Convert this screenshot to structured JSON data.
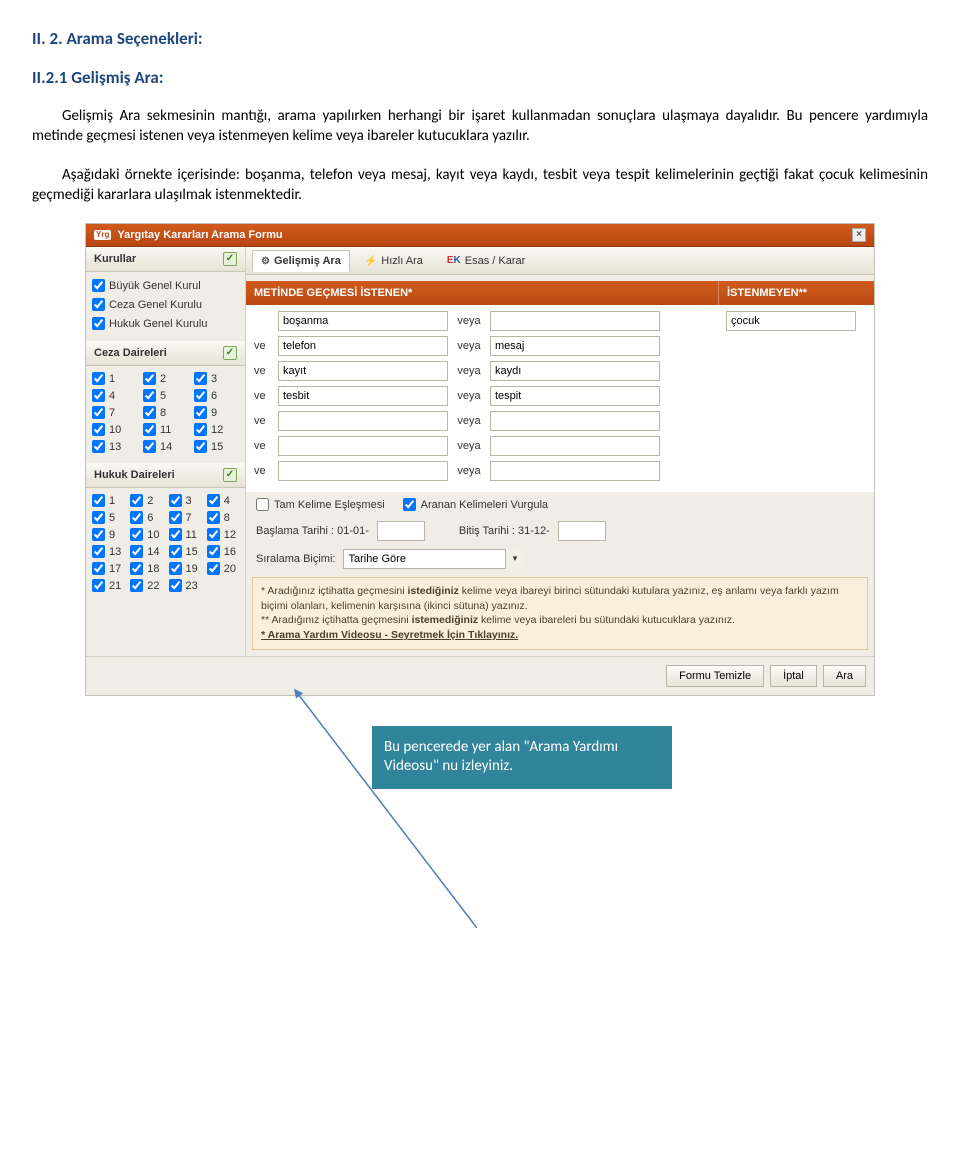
{
  "doc": {
    "h1": "II. 2. Arama Seçenekleri:",
    "h2": "II.2.1 Gelişmiş Ara:",
    "p1": "Gelişmiş Ara sekmesinin mantığı, arama yapılırken herhangi bir işaret kullanmadan sonuçlara ulaşmaya dayalıdır. Bu pencere yardımıyla metinde geçmesi istenen veya istenmeyen kelime veya ibareler kutucuklara yazılır.",
    "p2": "Aşağıdaki örnekte içerisinde: boşanma, telefon veya mesaj, kayıt veya kaydı, tesbit veya tespit kelimelerinin geçtiği fakat çocuk kelimesinin geçmediği kararlara ulaşılmak istenmektedir."
  },
  "app": {
    "logo": "Yrg",
    "title": "Yargıtay Kararları Arama Formu",
    "close": "×",
    "sidebar": {
      "kurullar_head": "Kurullar",
      "kurullar": [
        "Büyük Genel Kurul",
        "Ceza Genel Kurulu",
        "Hukuk Genel Kurulu"
      ],
      "ceza_head": "Ceza Daireleri",
      "ceza_rows": [
        [
          "1",
          "2",
          "3"
        ],
        [
          "4",
          "5",
          "6"
        ],
        [
          "7",
          "8",
          "9"
        ],
        [
          "10",
          "11",
          "12"
        ],
        [
          "13",
          "14",
          "15"
        ]
      ],
      "hukuk_head": "Hukuk Daireleri",
      "hukuk_rows": [
        [
          "1",
          "2",
          "3",
          "4"
        ],
        [
          "5",
          "6",
          "7",
          "8"
        ],
        [
          "9",
          "10",
          "11",
          "12"
        ],
        [
          "13",
          "14",
          "15",
          "16"
        ],
        [
          "17",
          "18",
          "19",
          "20"
        ],
        [
          "21",
          "22",
          "23",
          ""
        ]
      ]
    },
    "tabs": {
      "t1": "Gelişmiş Ara",
      "t2": "Hızlı Ara",
      "t3": "Esas / Karar"
    },
    "grid": {
      "h_istenen": "METİNDE GEÇMESİ İSTENEN*",
      "h_istenmeyen": "İSTENMEYEN**",
      "veya": "veya",
      "ve": "ve",
      "rows": [
        {
          "a": "boşanma",
          "b": ""
        },
        {
          "a": "telefon",
          "b": "mesaj"
        },
        {
          "a": "kayıt",
          "b": "kaydı"
        },
        {
          "a": "tesbit",
          "b": "tespit"
        },
        {
          "a": "",
          "b": ""
        },
        {
          "a": "",
          "b": ""
        },
        {
          "a": "",
          "b": ""
        }
      ],
      "unwanted": "çocuk"
    },
    "opts": {
      "tam": "Tam Kelime Eşleşmesi",
      "vurgu": "Aranan Kelimeleri Vurgula",
      "baslama": "Başlama Tarihi : 01-01-",
      "bitis": "Bitiş Tarihi : 31-12-",
      "siralama_label": "Sıralama Biçimi:",
      "siralama_val": "Tarihe Göre"
    },
    "help": {
      "l1": "* Aradığınız içtihatta geçmesini istediğiniz kelime veya ibareyi birinci sütundaki kutulara yazınız, eş anlamı veya farklı yazım biçimi olanları, kelimenin karşısına (ikinci sütuna) yazınız.",
      "l1b": "istediğiniz",
      "l2": "** Aradığınız içtihatta geçmesini istemediğiniz kelime veya ibareleri bu sütundaki kutucuklara yazınız.",
      "l2b": "istemediğiniz",
      "l3": "* Arama Yardım Videosu - Seyretmek İçin Tıklayınız."
    },
    "buttons": {
      "temizle": "Formu Temizle",
      "iptal": "İptal",
      "ara": "Ara"
    }
  },
  "callout": {
    "line1": "Bu pencerede yer alan \"Arama Yardımı Videosu\"",
    "line2": "nu izleyiniz."
  }
}
